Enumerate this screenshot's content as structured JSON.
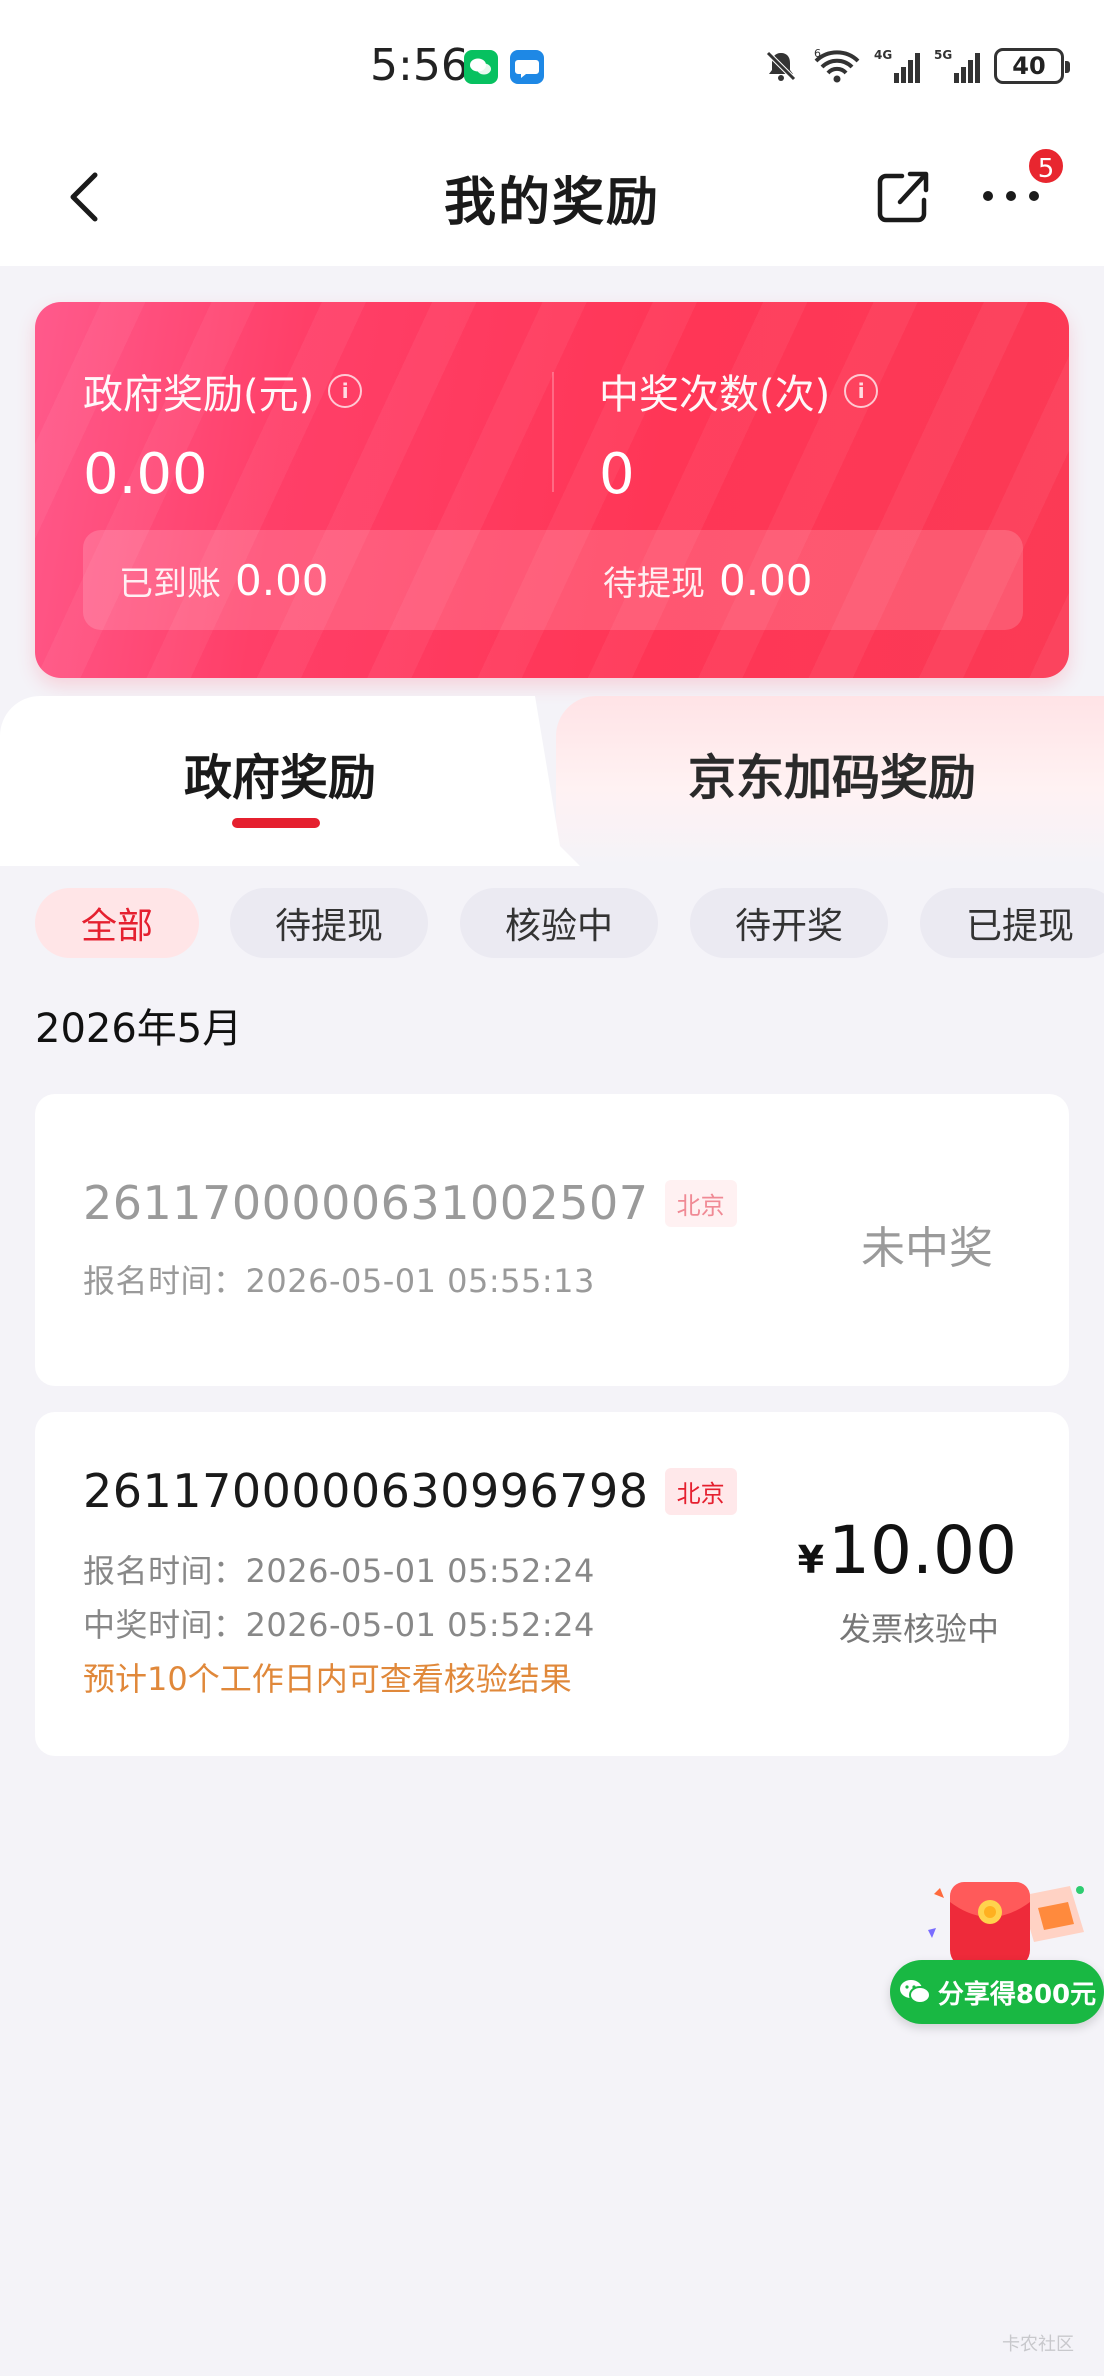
{
  "status_bar": {
    "time": "5:56",
    "icons": [
      "wechat-icon",
      "message-icon",
      "mute-icon",
      "wifi-icon",
      "signal-4g-icon",
      "signal-5g-icon",
      "battery-icon"
    ],
    "wifi_label": "6",
    "signal1_label": "4G",
    "signal2_label": "5G",
    "battery": "40"
  },
  "nav": {
    "title": "我的奖励",
    "more_badge": "5"
  },
  "summary": {
    "gov_reward_label": "政府奖励(元)",
    "gov_reward_value": "0.00",
    "win_count_label": "中奖次数(次)",
    "win_count_value": "0",
    "received_label": "已到账",
    "received_value": "0.00",
    "pending_label": "待提现",
    "pending_value": "0.00",
    "info_glyph": "i"
  },
  "tabs": [
    {
      "label": "政府奖励",
      "active": true
    },
    {
      "label": "京东加码奖励",
      "active": false
    }
  ],
  "filters": [
    {
      "label": "全部",
      "active": true
    },
    {
      "label": "待提现",
      "active": false
    },
    {
      "label": "核验中",
      "active": false
    },
    {
      "label": "待开奖",
      "active": false
    },
    {
      "label": "已提现",
      "active": false
    }
  ],
  "month": "2026年5月",
  "records": [
    {
      "order_no": "2611700000631002507",
      "region": "北京",
      "signup_time": "报名时间：2026-05-01 05:55:13",
      "status": "未中奖"
    },
    {
      "order_no": "2611700000630996798",
      "region": "北京",
      "signup_time": "报名时间：2026-05-01 05:52:24",
      "win_time": "中奖时间：2026-05-01 05:52:24",
      "hint": "预计10个工作日内可查看核验结果",
      "currency": "¥",
      "amount": "10.00",
      "status": "发票核验中"
    }
  ],
  "share_float": {
    "label": "分享得800元"
  },
  "watermark": "卡农社区",
  "colors": {
    "accent_red": "#e5202f",
    "card_gradient_start": "#ff5a8c",
    "card_gradient_end": "#fb3a55",
    "hint_orange": "#e0883a",
    "share_green": "#19b843"
  }
}
